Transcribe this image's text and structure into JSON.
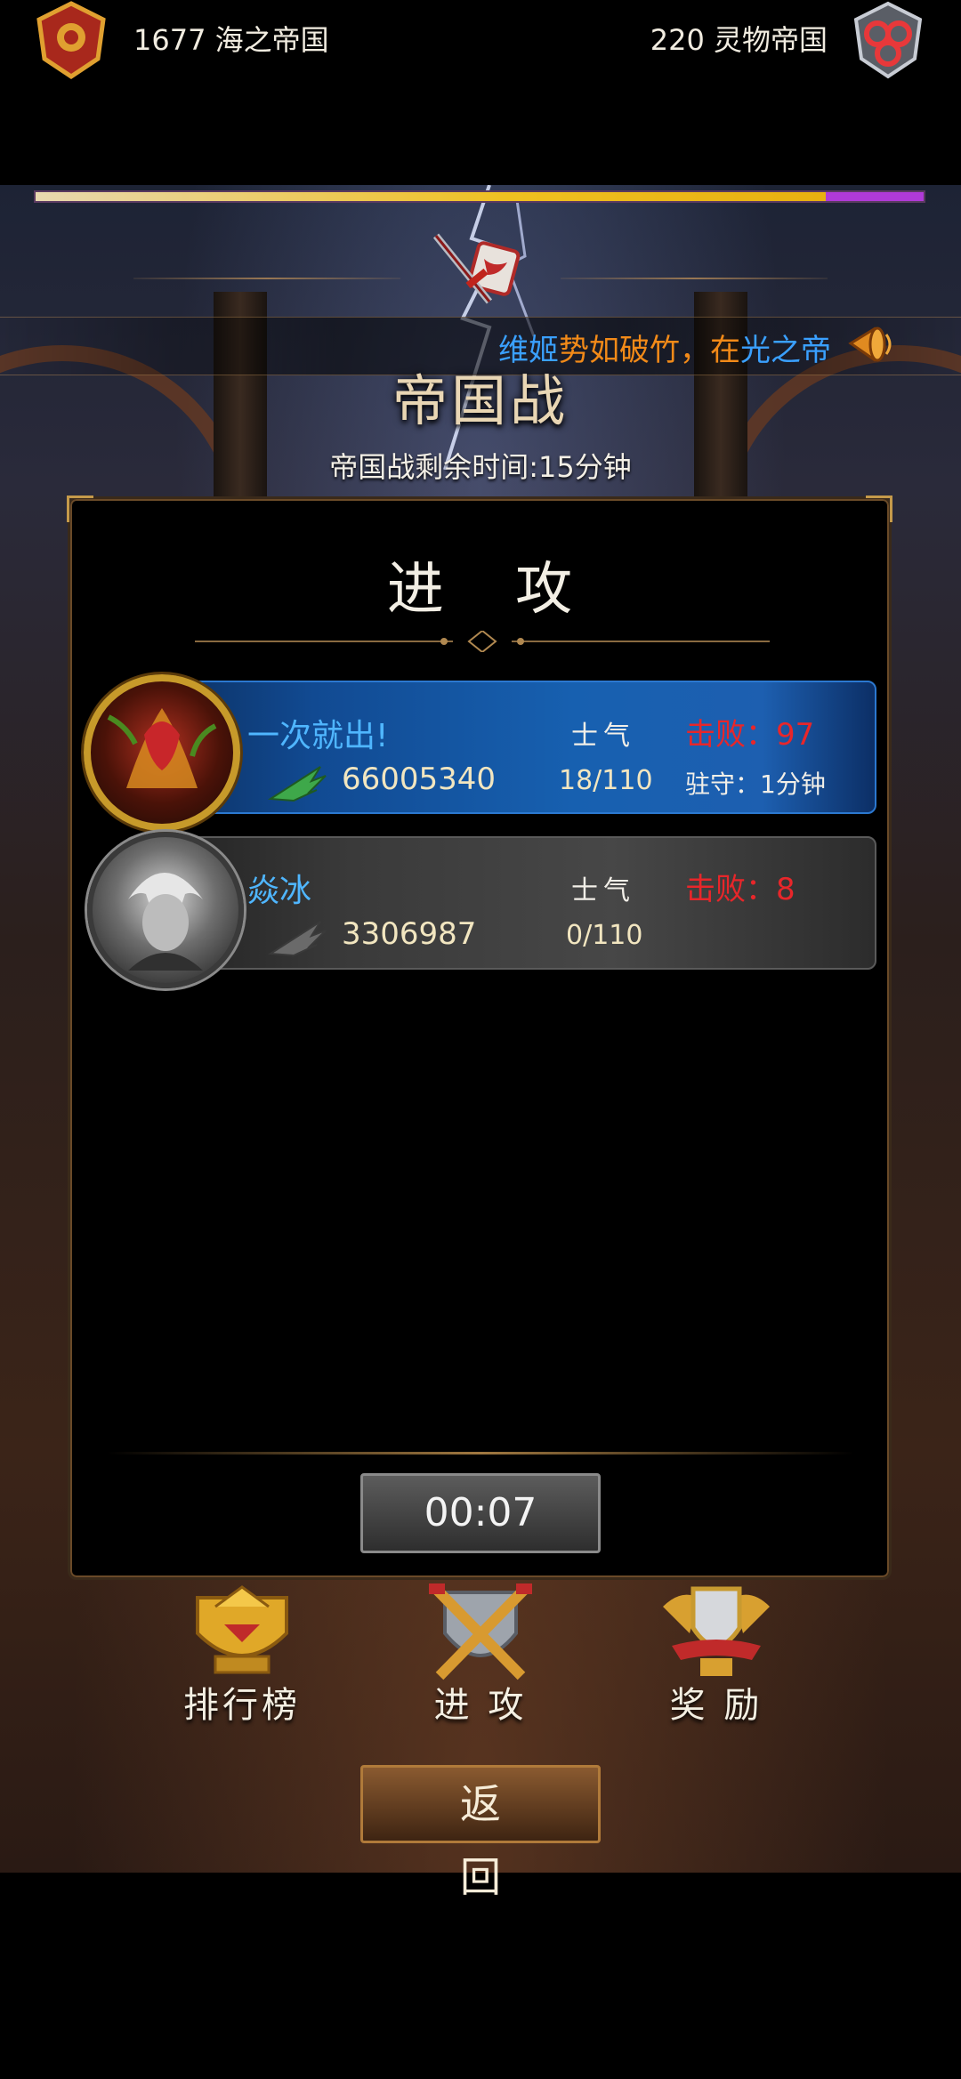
{
  "battle_progress": {
    "left_share": 0.89
  },
  "empires": {
    "left": {
      "score": "1677",
      "name": "海之帝国"
    },
    "right": {
      "score": "220",
      "name": "灵物帝国"
    }
  },
  "broadcast": {
    "part1": "维姬",
    "part2": "势如破竹，在",
    "part3": "光之帝"
  },
  "page_title": "帝国战",
  "time_remaining": "帝国战剩余时间:15分钟",
  "panel": {
    "title": "进 攻"
  },
  "players": [
    {
      "name": "一次就出!",
      "power": "66005340",
      "morale_label": "士气",
      "morale": "18/110",
      "defeat": "击败：97",
      "garrison": "驻守：1分钟"
    },
    {
      "name": "焱冰",
      "power": "3306987",
      "morale_label": "士气",
      "morale": "0/110",
      "defeat": "击败：8"
    }
  ],
  "countdown": "00:07",
  "nav": {
    "rank": "排行榜",
    "attack": "进 攻",
    "reward": "奖 励"
  },
  "back_button": "返 回",
  "colors": {
    "blue_name": "#4fb6ff",
    "red_defeat": "#e8262a",
    "orange_text": "#f28a18",
    "progress_yellow": "#f0c020",
    "progress_purple": "#b03ad8"
  },
  "icons": [
    "left-empire-emblem-icon",
    "right-empire-emblem-icon",
    "crossed-swords-icon",
    "horn-icon",
    "power-wing-icon",
    "trophy-rank-icon",
    "swords-shield-icon",
    "reward-shield-icon"
  ]
}
